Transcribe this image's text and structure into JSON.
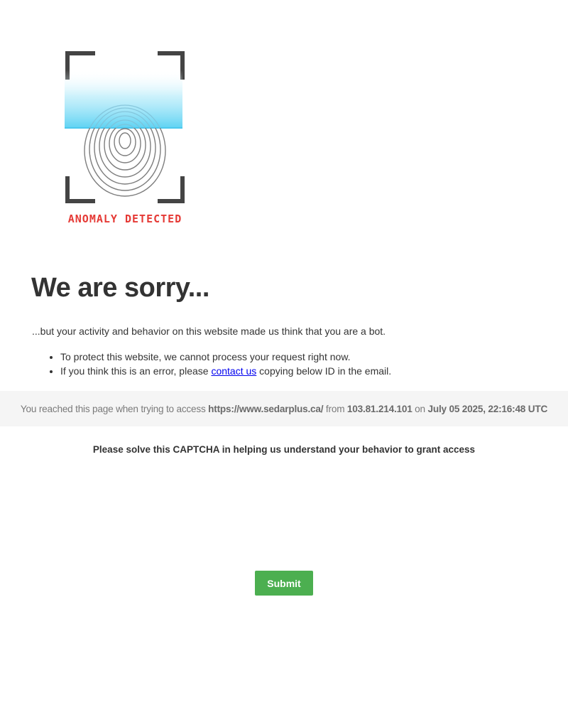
{
  "logo": {
    "caption": "ANOMALY DETECTED",
    "caption_color": "#e53935",
    "scan_color": "#5fd3f3",
    "frame_color": "#444444"
  },
  "title": "We are sorry...",
  "intro": "...but your activity and behavior on this website made us think that you are a bot.",
  "points": [
    "To protect this website, we cannot process your request right now.",
    "If you think this is an error, please "
  ],
  "contact_link": "contact us",
  "point_two_suffix": " copying below ID in the email.",
  "access": {
    "prefix": "You reached this page when trying to access ",
    "url": "https://www.sedarplus.ca/",
    "from_label": " from ",
    "ip": "103.81.214.101",
    "on_label": " on ",
    "timestamp": "July 05 2025, 22:16:48 UTC"
  },
  "captcha_note": "Please solve this CAPTCHA in helping us understand your behavior to grant access",
  "submit_label": "Submit",
  "accent_color": "#4caf50"
}
